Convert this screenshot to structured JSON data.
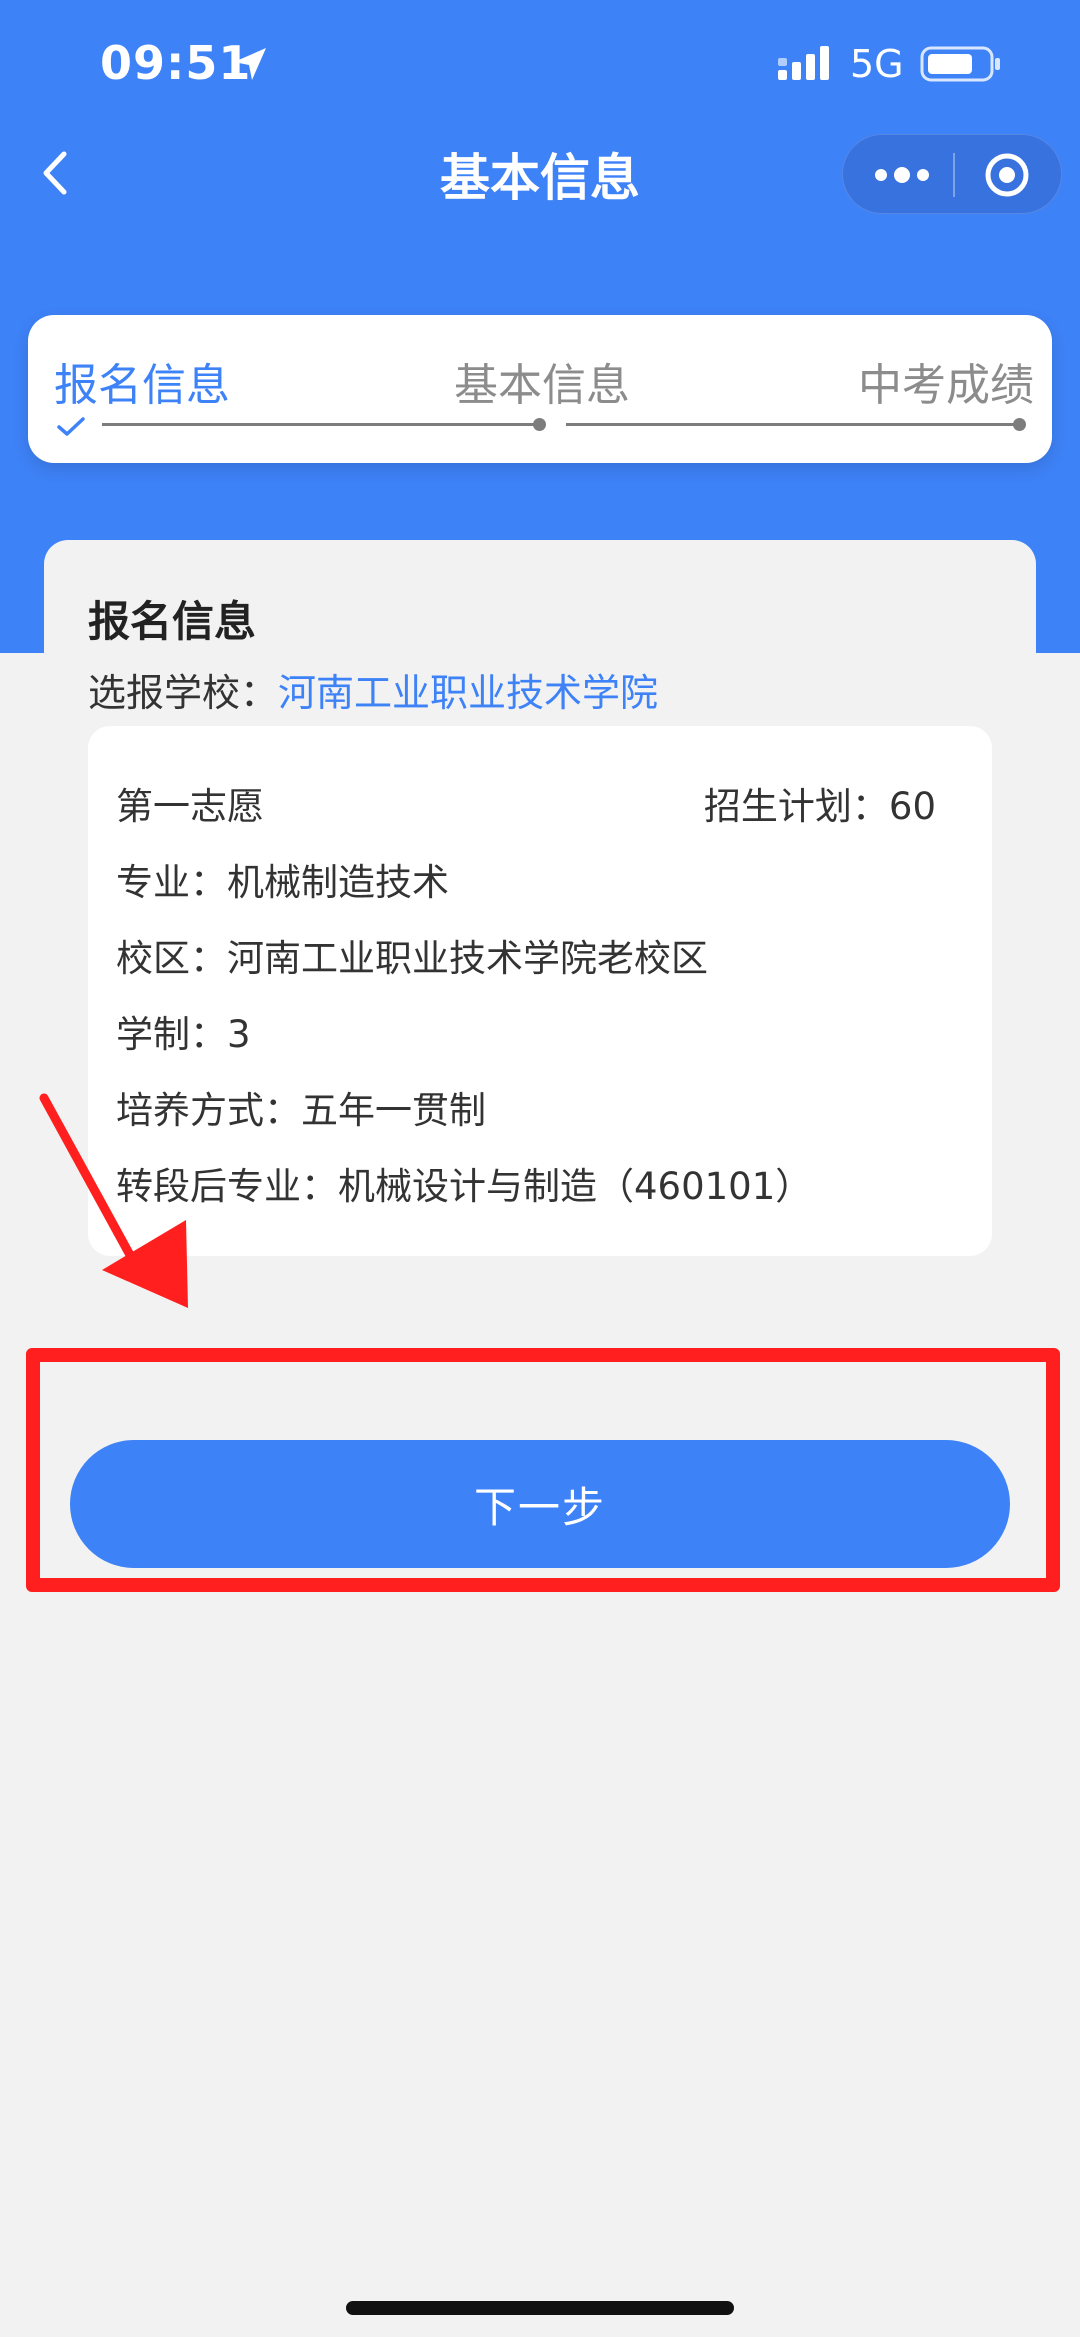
{
  "status_bar": {
    "time": "09:51",
    "network": "5G",
    "icons": [
      "location-arrow-icon",
      "signal-icon",
      "battery-icon"
    ]
  },
  "nav": {
    "title": "基本信息",
    "icons": [
      "back-chevron-icon",
      "more-dots-icon",
      "close-target-icon"
    ]
  },
  "steps": [
    {
      "label": "报名信息",
      "state": "active"
    },
    {
      "label": "基本信息",
      "state": "pending"
    },
    {
      "label": "中考成绩",
      "state": "pending"
    }
  ],
  "info": {
    "section_title": "报名信息",
    "school_label": "选报学校：",
    "school_name": "河南工业职业技术学院",
    "choice": {
      "title": "第一志愿",
      "plan": "招生计划：60",
      "major": "专业：机械制造技术",
      "campus": "校区：河南工业职业技术学院老校区",
      "duration": "学制：3",
      "mode": "培养方式：五年一贯制",
      "transfer_major": "转段后专业：机械设计与制造（460101）"
    }
  },
  "actions": {
    "next_label": "下一步"
  },
  "colors": {
    "primary": "#3e82f7",
    "background": "#f2f2f2",
    "annotation": "#ff1f1f"
  }
}
